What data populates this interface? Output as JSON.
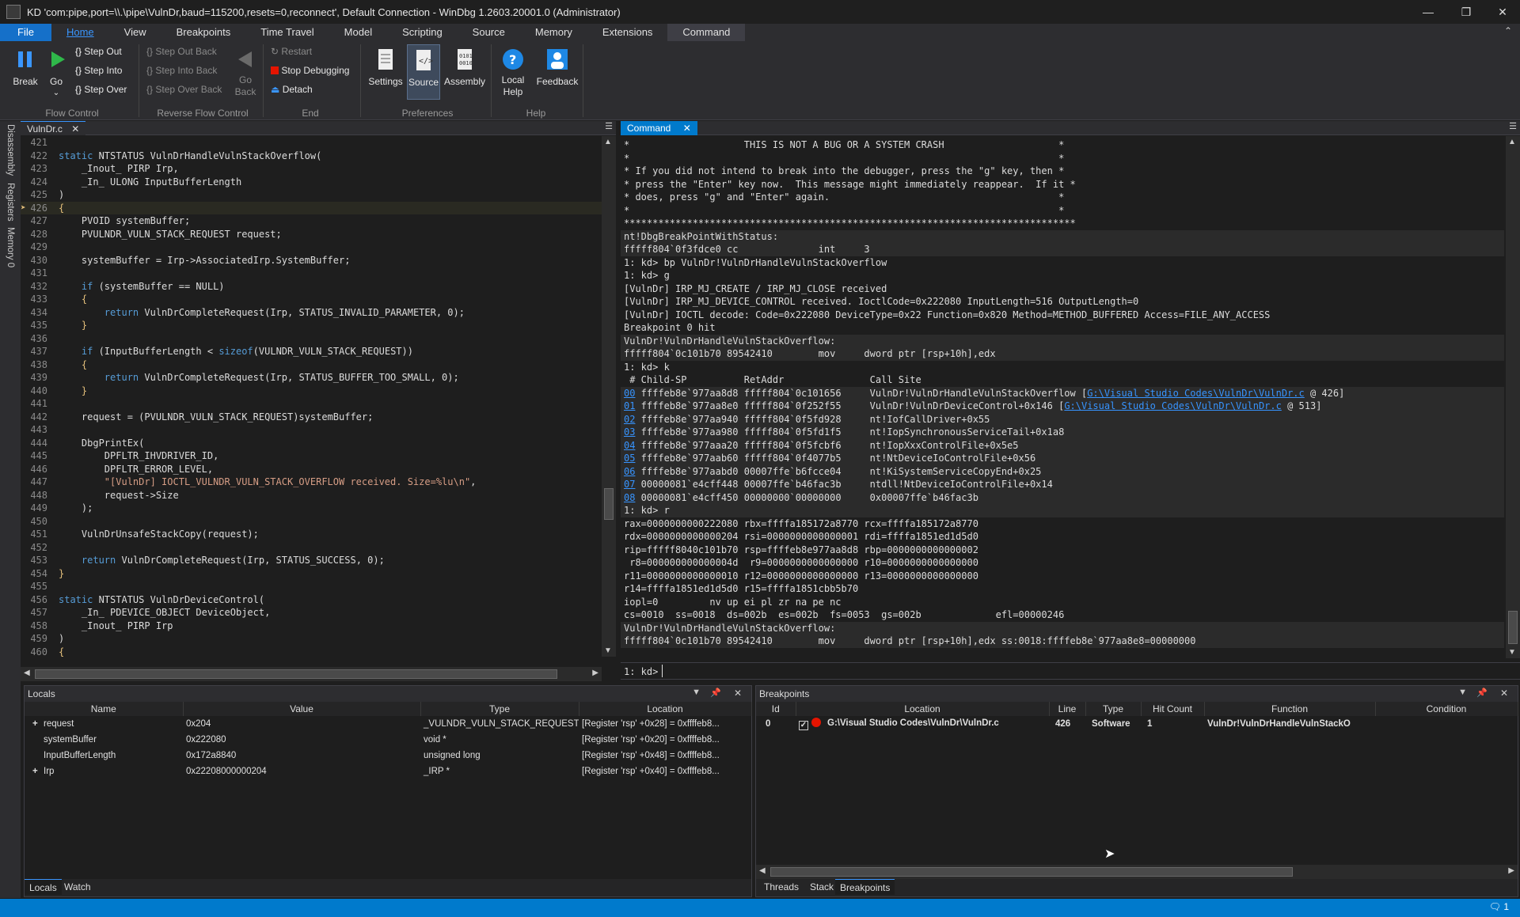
{
  "window": {
    "title": "KD 'com:pipe,port=\\\\.\\pipe\\VulnDr,baud=115200,resets=0,reconnect', Default Connection  - WinDbg 1.2603.20001.0 (Administrator)"
  },
  "menu": [
    "File",
    "Home",
    "View",
    "Breakpoints",
    "Time Travel",
    "Model",
    "Scripting",
    "Source",
    "Memory",
    "Extensions",
    "Command"
  ],
  "ribbon": {
    "break": "Break",
    "go": "Go",
    "step_out": "Step Out",
    "step_into": "Step Into",
    "step_over": "Step Over",
    "step_out_back": "Step Out Back",
    "step_into_back": "Step Into Back",
    "step_over_back": "Step Over Back",
    "go_back": "Go\nBack",
    "restart": "Restart",
    "stop_debugging": "Stop Debugging",
    "detach": "Detach",
    "settings": "Settings",
    "source": "Source",
    "assembly": "Assembly",
    "local_help": "Local\nHelp",
    "feedback": "Feedback",
    "groups": {
      "flow": "Flow Control",
      "reverse": "Reverse Flow Control",
      "end": "End",
      "prefs": "Preferences",
      "help": "Help"
    }
  },
  "side_tabs": [
    "Disassembly",
    "Registers",
    "Memory 0"
  ],
  "source": {
    "tab": "VulnDr.c",
    "lines": [
      {
        "n": "421",
        "t": ""
      },
      {
        "n": "422",
        "t": "static NTSTATUS VulnDrHandleVulnStackOverflow("
      },
      {
        "n": "423",
        "t": "    _Inout_ PIRP Irp,"
      },
      {
        "n": "424",
        "t": "    _In_ ULONG InputBufferLength"
      },
      {
        "n": "425",
        "t": ")"
      },
      {
        "n": "426",
        "t": "{"
      },
      {
        "n": "427",
        "t": "    PVOID systemBuffer;"
      },
      {
        "n": "428",
        "t": "    PVULNDR_VULN_STACK_REQUEST request;"
      },
      {
        "n": "429",
        "t": ""
      },
      {
        "n": "430",
        "t": "    systemBuffer = Irp->AssociatedIrp.SystemBuffer;"
      },
      {
        "n": "431",
        "t": ""
      },
      {
        "n": "432",
        "t": "    if (systemBuffer == NULL)"
      },
      {
        "n": "433",
        "t": "    {"
      },
      {
        "n": "434",
        "t": "        return VulnDrCompleteRequest(Irp, STATUS_INVALID_PARAMETER, 0);"
      },
      {
        "n": "435",
        "t": "    }"
      },
      {
        "n": "436",
        "t": ""
      },
      {
        "n": "437",
        "t": "    if (InputBufferLength < sizeof(VULNDR_VULN_STACK_REQUEST))"
      },
      {
        "n": "438",
        "t": "    {"
      },
      {
        "n": "439",
        "t": "        return VulnDrCompleteRequest(Irp, STATUS_BUFFER_TOO_SMALL, 0);"
      },
      {
        "n": "440",
        "t": "    }"
      },
      {
        "n": "441",
        "t": ""
      },
      {
        "n": "442",
        "t": "    request = (PVULNDR_VULN_STACK_REQUEST)systemBuffer;"
      },
      {
        "n": "443",
        "t": ""
      },
      {
        "n": "444",
        "t": "    DbgPrintEx("
      },
      {
        "n": "445",
        "t": "        DPFLTR_IHVDRIVER_ID,"
      },
      {
        "n": "446",
        "t": "        DPFLTR_ERROR_LEVEL,"
      },
      {
        "n": "447",
        "t": "        \"[VulnDr] IOCTL_VULNDR_VULN_STACK_OVERFLOW received. Size=%lu\\n\","
      },
      {
        "n": "448",
        "t": "        request->Size"
      },
      {
        "n": "449",
        "t": "    );"
      },
      {
        "n": "450",
        "t": ""
      },
      {
        "n": "451",
        "t": "    VulnDrUnsafeStackCopy(request);"
      },
      {
        "n": "452",
        "t": ""
      },
      {
        "n": "453",
        "t": "    return VulnDrCompleteRequest(Irp, STATUS_SUCCESS, 0);"
      },
      {
        "n": "454",
        "t": "}"
      },
      {
        "n": "455",
        "t": ""
      },
      {
        "n": "456",
        "t": "static NTSTATUS VulnDrDeviceControl("
      },
      {
        "n": "457",
        "t": "    _In_ PDEVICE_OBJECT DeviceObject,"
      },
      {
        "n": "458",
        "t": "    _Inout_ PIRP Irp"
      },
      {
        "n": "459",
        "t": ")"
      },
      {
        "n": "460",
        "t": "{"
      },
      {
        "n": "461",
        "t": "    UNREFERENCED_PARAMETER(DeviceObject);"
      }
    ]
  },
  "command": {
    "tab": "Command",
    "lines": [
      "*                    THIS IS NOT A BUG OR A SYSTEM CRASH                    *",
      "*                                                                           *",
      "* If you did not intend to break into the debugger, press the \"g\" key, then *",
      "* press the \"Enter\" key now.  This message might immediately reappear.  If it *",
      "* does, press \"g\" and \"Enter\" again.                                        *",
      "*                                                                           *",
      "*******************************************************************************",
      "nt!DbgBreakPointWithStatus:",
      "fffff804`0f3fdce0 cc              int     3",
      "1: kd> bp VulnDr!VulnDrHandleVulnStackOverflow",
      "1: kd> g",
      "[VulnDr] IRP_MJ_CREATE / IRP_MJ_CLOSE received",
      "[VulnDr] IRP_MJ_DEVICE_CONTROL received. IoctlCode=0x222080 InputLength=516 OutputLength=0",
      "[VulnDr] IOCTL decode: Code=0x222080 DeviceType=0x22 Function=0x820 Method=METHOD_BUFFERED Access=FILE_ANY_ACCESS",
      "Breakpoint 0 hit",
      "VulnDr!VulnDrHandleVulnStackOverflow:",
      "fffff804`0c101b70 89542410        mov     dword ptr [rsp+10h],edx",
      "1: kd> k",
      " # Child-SP          RetAddr               Call Site"
    ],
    "frames": [
      {
        "n": "00",
        "t": " ffffeb8e`977aa8d8 fffff804`0c101656     VulnDr!VulnDrHandleVulnStackOverflow [",
        "link": "G:\\Visual Studio Codes\\VulnDr\\VulnDr.c",
        "tail": " @ 426]"
      },
      {
        "n": "01",
        "t": " ffffeb8e`977aa8e0 fffff804`0f252f55     VulnDr!VulnDrDeviceControl+0x146 [",
        "link": "G:\\Visual Studio Codes\\VulnDr\\VulnDr.c",
        "tail": " @ 513]"
      },
      {
        "n": "02",
        "t": " ffffeb8e`977aa940 fffff804`0f5fd928     nt!IofCallDriver+0x55",
        "link": "",
        "tail": ""
      },
      {
        "n": "03",
        "t": " ffffeb8e`977aa980 fffff804`0f5fd1f5     nt!IopSynchronousServiceTail+0x1a8",
        "link": "",
        "tail": ""
      },
      {
        "n": "04",
        "t": " ffffeb8e`977aaa20 fffff804`0f5fcbf6     nt!IopXxxControlFile+0x5e5",
        "link": "",
        "tail": ""
      },
      {
        "n": "05",
        "t": " ffffeb8e`977aab60 fffff804`0f4077b5     nt!NtDeviceIoControlFile+0x56",
        "link": "",
        "tail": ""
      },
      {
        "n": "06",
        "t": " ffffeb8e`977aabd0 00007ffe`b6fcce04     nt!KiSystemServiceCopyEnd+0x25",
        "link": "",
        "tail": ""
      },
      {
        "n": "07",
        "t": " 00000081`e4cff448 00007ffe`b46fac3b     ntdll!NtDeviceIoControlFile+0x14",
        "link": "",
        "tail": ""
      },
      {
        "n": "08",
        "t": " 00000081`e4cff450 00000000`00000000     0x00007ffe`b46fac3b",
        "link": "",
        "tail": ""
      }
    ],
    "lines2": [
      "1: kd> r",
      "rax=0000000000222080 rbx=ffffa185172a8770 rcx=ffffa185172a8770",
      "rdx=0000000000000204 rsi=0000000000000001 rdi=ffffa1851ed1d5d0",
      "rip=fffff8040c101b70 rsp=ffffeb8e977aa8d8 rbp=0000000000000002",
      " r8=000000000000004d  r9=0000000000000000 r10=0000000000000000",
      "r11=0000000000000010 r12=0000000000000000 r13=0000000000000000",
      "r14=ffffa1851ed1d5d0 r15=ffffa1851cbb5b70",
      "iopl=0         nv up ei pl zr na pe nc",
      "cs=0010  ss=0018  ds=002b  es=002b  fs=0053  gs=002b             efl=00000246",
      "VulnDr!VulnDrHandleVulnStackOverflow:",
      "fffff804`0c101b70 89542410        mov     dword ptr [rsp+10h],edx ss:0018:ffffeb8e`977aa8e8=00000000"
    ],
    "prompt": "1: kd>"
  },
  "locals": {
    "title": "Locals",
    "columns": [
      "Name",
      "Value",
      "Type",
      "Location"
    ],
    "rows": [
      {
        "expand": "+",
        "name": "request",
        "value": "0x204",
        "type": "_VULNDR_VULN_STACK_REQUEST *",
        "loc": "[Register 'rsp' +0x28] = 0xffffeb8..."
      },
      {
        "expand": "",
        "name": "systemBuffer",
        "value": "0x222080",
        "type": "void *",
        "loc": "[Register 'rsp' +0x20] = 0xffffeb8..."
      },
      {
        "expand": "",
        "name": "InputBufferLength",
        "value": "0x172a8840",
        "type": "unsigned long",
        "loc": "[Register 'rsp' +0x48] = 0xffffeb8..."
      },
      {
        "expand": "+",
        "name": "Irp",
        "value": "0x22208000000204",
        "type": "_IRP *",
        "loc": "[Register 'rsp' +0x40] = 0xffffeb8..."
      }
    ],
    "tabs": [
      "Locals",
      "Watch"
    ]
  },
  "breakpoints": {
    "title": "Breakpoints",
    "columns": [
      "Id",
      "Location",
      "Line",
      "Type",
      "Hit Count",
      "Function",
      "Condition"
    ],
    "rows": [
      {
        "id": "0",
        "location": "G:\\Visual Studio Codes\\VulnDr\\VulnDr.c",
        "line": "426",
        "type": "Software",
        "hits": "1",
        "function": "VulnDr!VulnDrHandleVulnStackO",
        "condition": ""
      }
    ],
    "tabs": [
      "Threads",
      "Stack",
      "Breakpoints"
    ]
  },
  "status": {
    "count": "1"
  },
  "colors": {
    "accent": "#007acc",
    "file_menu": "#1570c9",
    "link": "#3794ff",
    "string": "#d69d85",
    "keyword": "#569cd6",
    "breakpoint": "#e51400"
  }
}
